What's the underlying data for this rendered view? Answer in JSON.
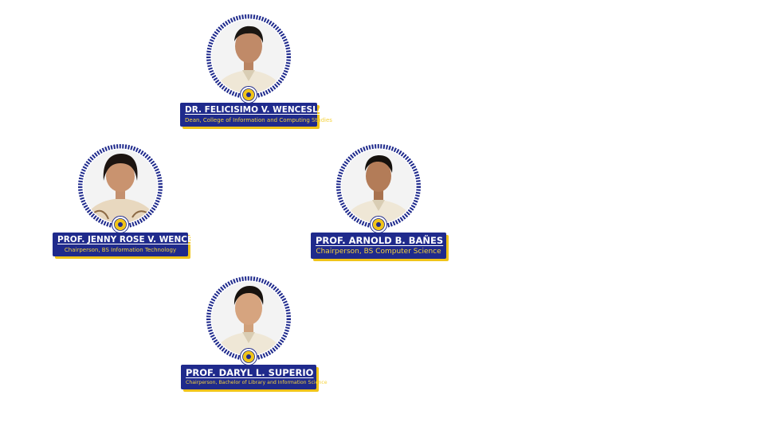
{
  "accent_colors": {
    "ring": "#1f2a8c",
    "plate": "#1f2a8c",
    "plate_shadow": "#f0c419",
    "role_text": "#f5d23a",
    "barong": "#efe7d6"
  },
  "people": [
    {
      "id": "dean",
      "name": "DR. FELICISIMO V. WENCESLAO, JR.",
      "role": "Dean, College of Information and Computing Studies",
      "icon": "seal-icon"
    },
    {
      "id": "chair-it",
      "name": "PROF. JENNY ROSE V. WENCESLAO",
      "role": "Chairperson, BS Information Technology",
      "icon": "seal-icon"
    },
    {
      "id": "chair-cs",
      "name": "PROF. ARNOLD B. BAÑES",
      "role": "Chairperson, BS Computer Science",
      "icon": "seal-icon"
    },
    {
      "id": "chair-lis",
      "name": "PROF. DARYL L. SUPERIO",
      "role": "Chairperson, Bachelor of Library and Information Science",
      "icon": "seal-icon"
    }
  ]
}
